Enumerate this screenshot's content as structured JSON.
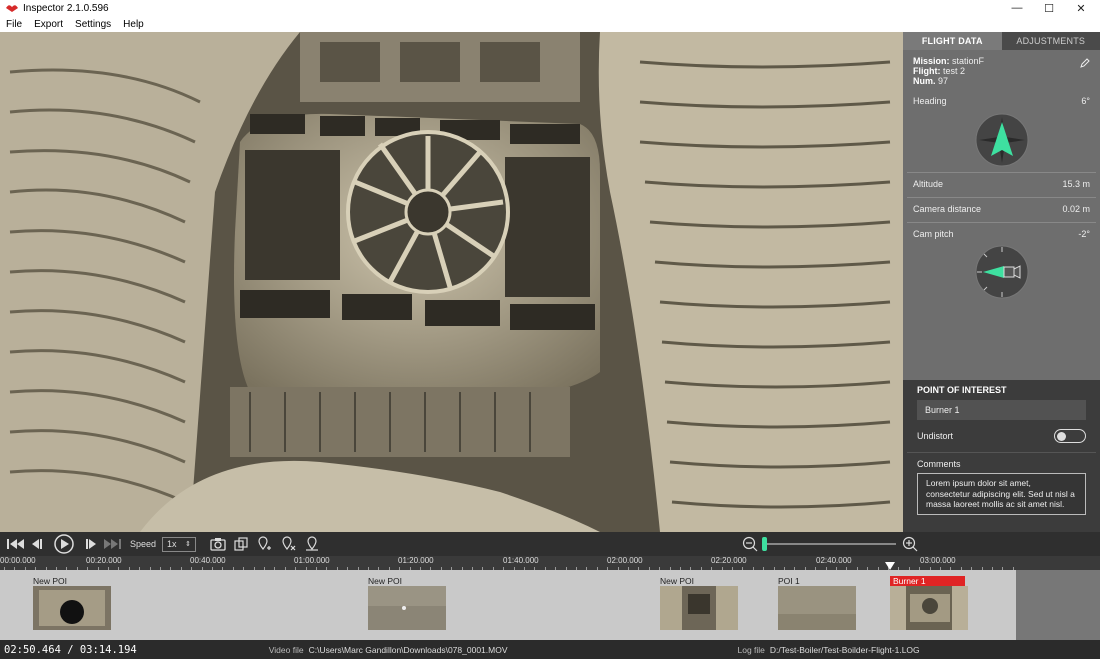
{
  "app": {
    "title": "Inspector 2.1.0.596"
  },
  "window": {
    "minimize": "—",
    "maximize": "☐",
    "close": "✕"
  },
  "menu": [
    "File",
    "Export",
    "Settings",
    "Help"
  ],
  "side": {
    "tabs": [
      "FLIGHT DATA",
      "ADJUSTMENTS"
    ],
    "mission_label": "Mission:",
    "mission": "stationF",
    "flight_label": "Flight:",
    "flight": "test 2",
    "num_label": "Num.",
    "num": "97",
    "heading_label": "Heading",
    "heading": "6°",
    "altitude_label": "Altitude",
    "altitude": "15.3 m",
    "camdist_label": "Camera distance",
    "camdist": "0.02 m",
    "campitch_label": "Cam pitch",
    "campitch": "-2°"
  },
  "poi": {
    "title": "POINT OF INTEREST",
    "name": "Burner 1",
    "undistort_label": "Undistort",
    "comments_label": "Comments",
    "comments": "Lorem ipsum dolor sit amet, consectetur adipiscing elit. Sed ut nisl a massa laoreet mollis ac sit amet nisl."
  },
  "controls": {
    "speed_label": "Speed",
    "speed": "1x",
    "zoom_level": 0.0
  },
  "timeline": {
    "labels": [
      "00:00.000",
      "00:20.000",
      "00:40.000",
      "01:00.000",
      "01:20.000",
      "01:40.000",
      "02:00.000",
      "02:20.000",
      "02:40.000",
      "03:00.000"
    ],
    "clips": [
      "New POI",
      "New POI",
      "New POI",
      "POI 1",
      "Burner 1"
    ]
  },
  "status": {
    "time": "02:50.464 / 03:14.194",
    "video_label": "Video file",
    "video": "C:\\Users\\Marc Gandillon\\Downloads\\078_0001.MOV",
    "log_label": "Log file",
    "log": "D:/Test-Boiler/Test-Boilder-Flight-1.LOG"
  },
  "colors": {
    "accent": "#3ee0a0",
    "selected_clip": "#e02424"
  }
}
